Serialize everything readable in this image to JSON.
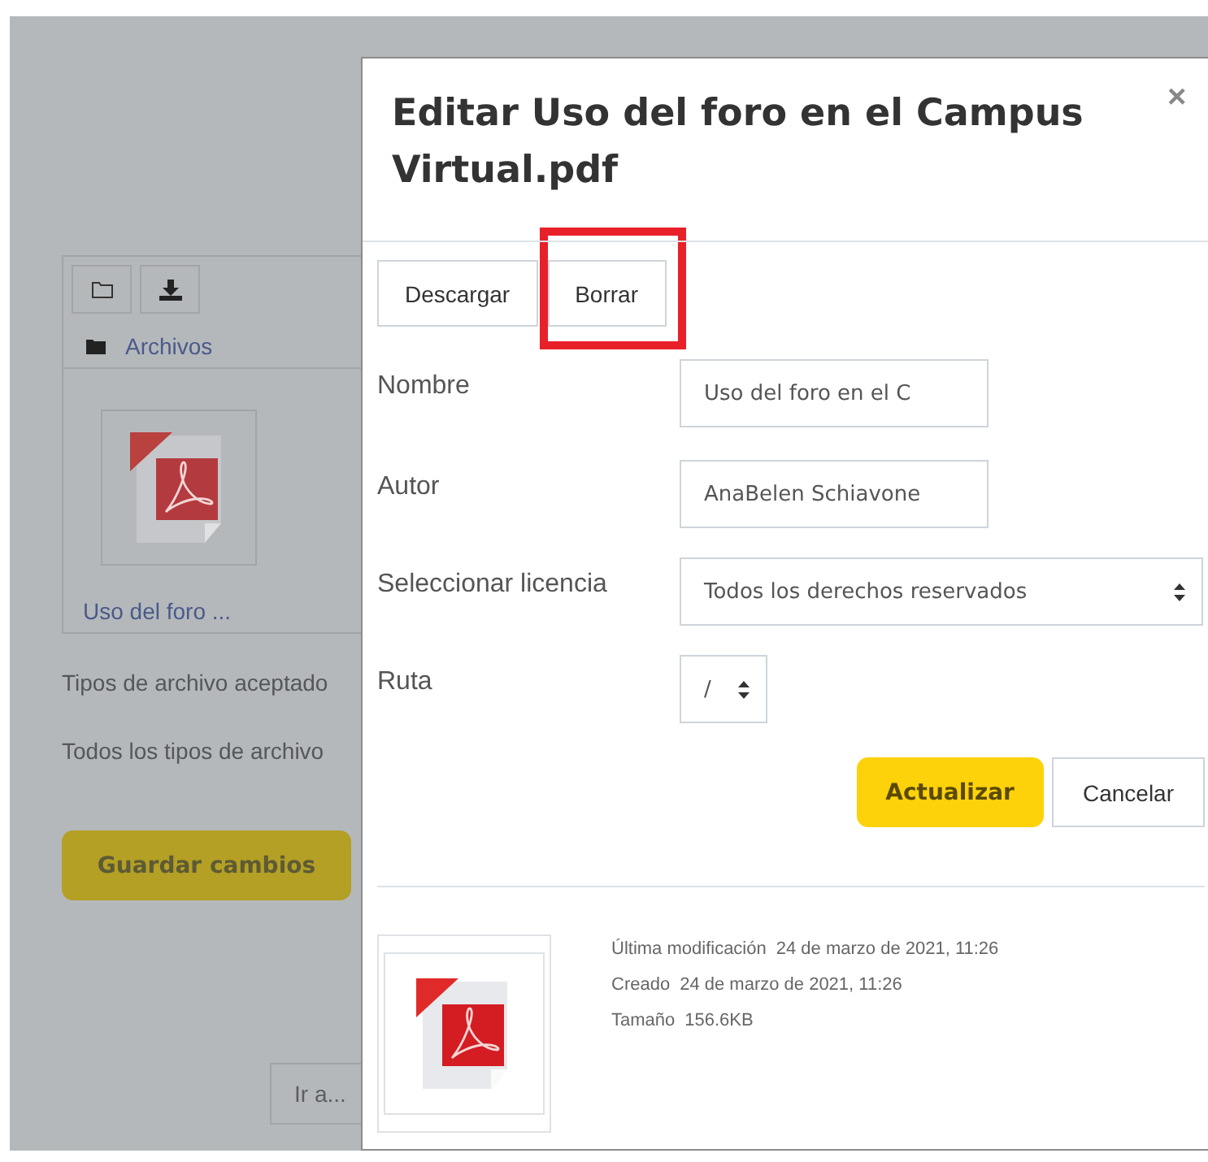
{
  "background": {
    "breadcrumb": "Archivos",
    "file_name": "Uso del foro ...",
    "accepted_types_label": "Tipos de archivo aceptado",
    "all_types_text": "Todos los tipos de archivo",
    "save_button": "Guardar cambios",
    "jump_button": "Ir a..."
  },
  "dialog": {
    "title": "Editar Uso del foro en el Campus Virtual.pdf",
    "close": "×",
    "actions": [
      {
        "label": "Descargar",
        "highlighted": false
      },
      {
        "label": "Borrar",
        "highlighted": true
      }
    ],
    "fields": [
      {
        "kind": "text",
        "label": "Nombre",
        "value": "Uso del foro en el C"
      },
      {
        "kind": "text",
        "label": "Autor",
        "value": "AnaBelen Schiavone"
      },
      {
        "kind": "select",
        "label": "Seleccionar licencia",
        "value": "Todos los derechos reservados"
      },
      {
        "kind": "select",
        "label": "Ruta",
        "value": "/"
      }
    ],
    "buttons": [
      {
        "label": "Actualizar",
        "primary": true
      },
      {
        "label": "Cancelar",
        "primary": false
      }
    ],
    "details": [
      {
        "label": "Última modificación",
        "value": "24 de marzo de 2021, 11:26"
      },
      {
        "label": "Creado",
        "value": "24 de marzo de 2021, 11:26"
      },
      {
        "label": "Tamaño",
        "value": "156.6KB"
      }
    ]
  }
}
